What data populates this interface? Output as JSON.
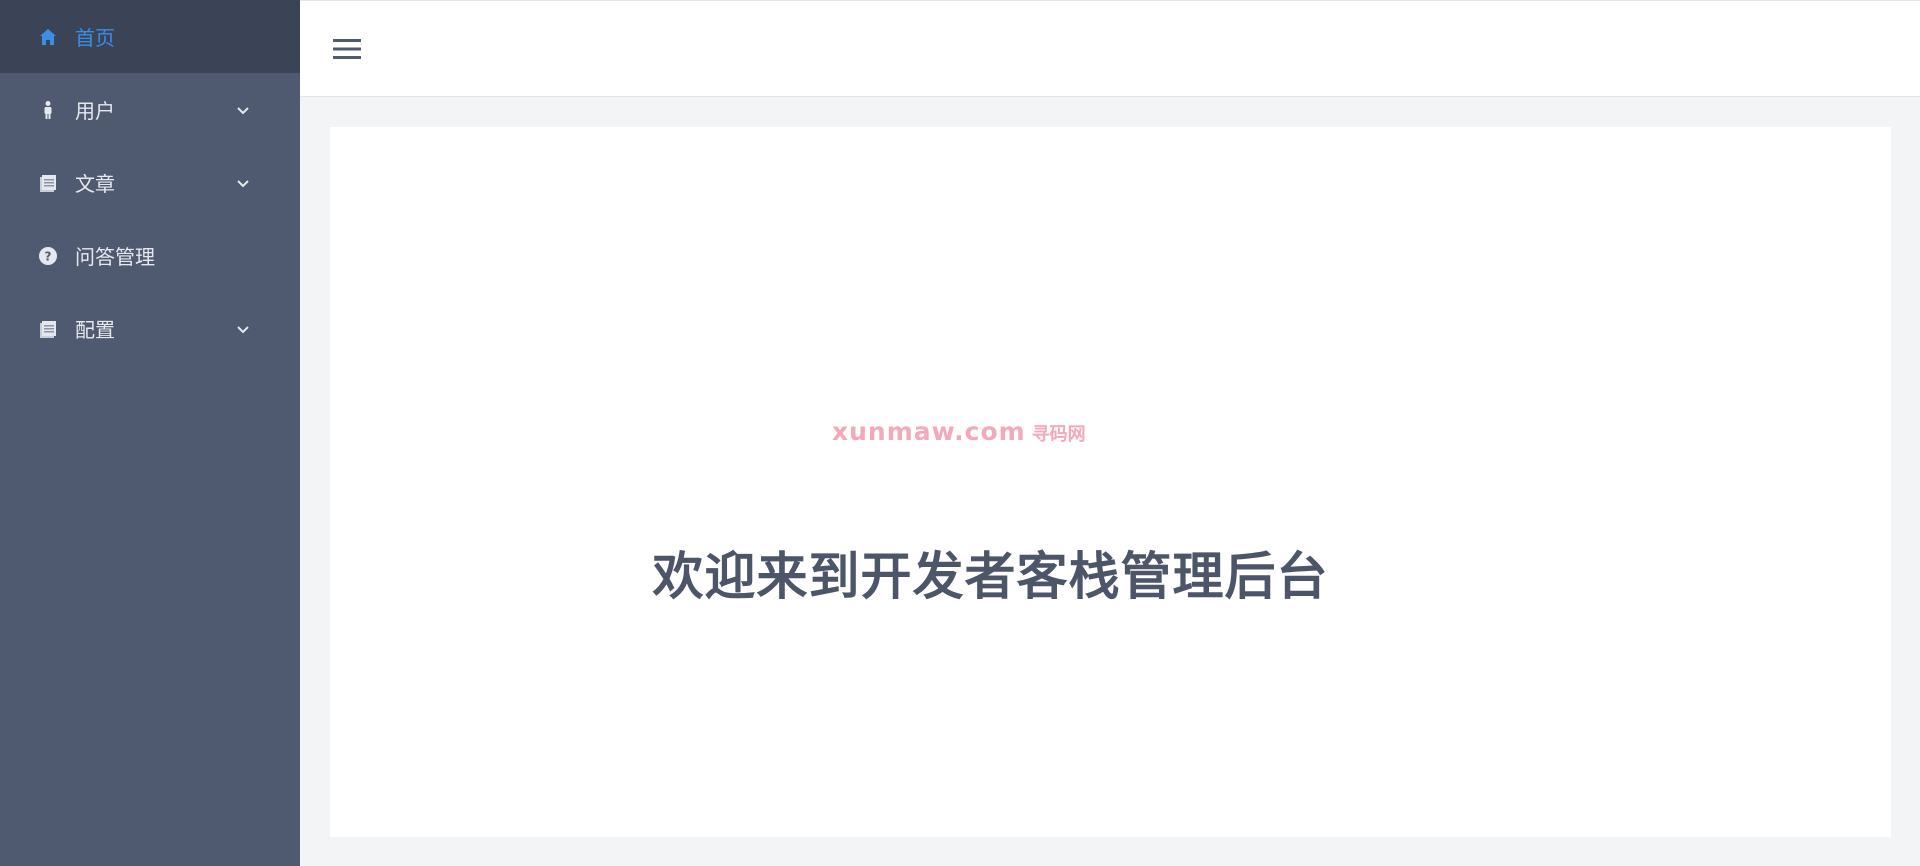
{
  "sidebar": {
    "items": [
      {
        "label": "首页",
        "icon": "home-icon",
        "active": true,
        "expandable": false
      },
      {
        "label": "用户",
        "icon": "user-icon",
        "active": false,
        "expandable": true
      },
      {
        "label": "文章",
        "icon": "document-icon",
        "active": false,
        "expandable": true
      },
      {
        "label": "问答管理",
        "icon": "question-icon",
        "active": false,
        "expandable": false
      },
      {
        "label": "配置",
        "icon": "document-icon",
        "active": false,
        "expandable": true
      }
    ]
  },
  "header": {
    "toggle_icon": "hamburger-icon"
  },
  "main": {
    "watermark": "xunmaw.com",
    "watermark_cn": "寻码网",
    "welcome": "欢迎来到开发者客栈管理后台"
  },
  "colors": {
    "sidebar_bg": "#4f5a70",
    "sidebar_active_bg": "#3b4457",
    "accent": "#3a8ee6",
    "welcome_text": "#4d5568",
    "watermark": "#f3a9ba"
  }
}
